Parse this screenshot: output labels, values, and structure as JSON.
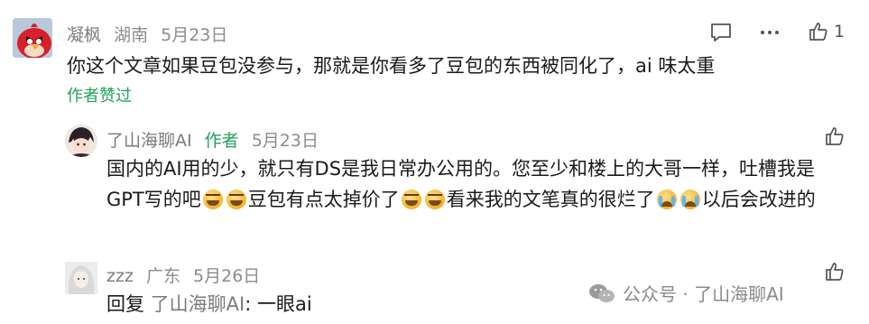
{
  "comment1": {
    "username": "凝枫",
    "location": "湖南",
    "date": "5月23日",
    "text": "你这个文章如果豆包没参与，那就是你看多了豆包的东西被同化了，ai 味太重",
    "liked_by_author": "作者赞过",
    "like_count": "1",
    "avatar_icon": "angry-bird-avatar",
    "reply_icon": "comment-icon",
    "more_icon": "more-dots-icon",
    "like_icon": "thumbs-up-icon"
  },
  "reply1": {
    "username": "了山海聊AI",
    "author_badge": "作者",
    "date": "5月23日",
    "text_a": "国内的AI用的少，就只有DS是我日常办公用的。您至少和楼上的大哥一样，吐槽我是GPT写的吧",
    "text_b": "豆包有点太掉价了",
    "text_c": "看来我的文笔真的很烂了",
    "text_d": "以后会改进的",
    "avatar_icon": "anime-avatar",
    "like_icon": "thumbs-up-icon"
  },
  "reply2": {
    "username": "zzz",
    "location": "广东",
    "date": "5月26日",
    "reply_prefix": "回复",
    "reply_target": "了山海聊AI",
    "text": ": 一眼ai",
    "avatar_icon": "girl-avatar",
    "like_icon": "thumbs-up-icon"
  },
  "watermark": {
    "text": "公众号 · 了山海聊AI",
    "icon": "wechat-icon"
  }
}
